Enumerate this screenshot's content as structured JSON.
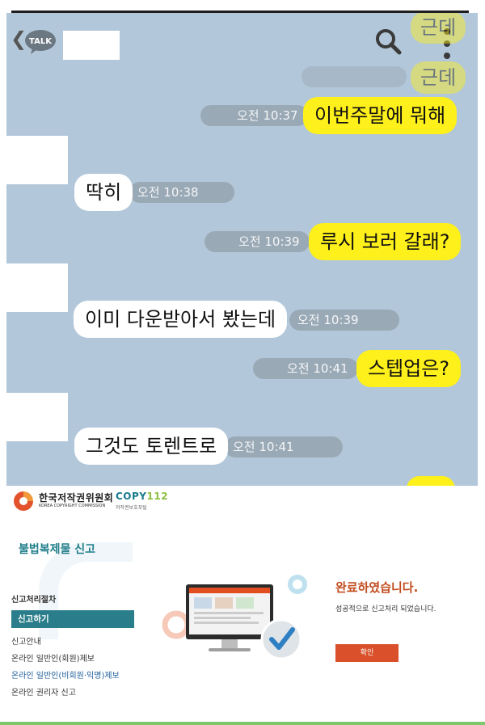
{
  "chat": {
    "app_icon_label": "TALK",
    "messages": [
      {
        "side": "me",
        "text": "이번주말에 뭐해",
        "time": "오전 10:37"
      },
      {
        "side": "them",
        "text": "딱히",
        "time": "오전 10:38"
      },
      {
        "side": "me",
        "text": "루시 보러 갈래?",
        "time": "오전 10:39"
      },
      {
        "side": "them",
        "text": "이미 다운받아서 봤는데",
        "time": "오전 10:39"
      },
      {
        "side": "me",
        "text": "스텝업은?",
        "time": "오전 10:41"
      },
      {
        "side": "them",
        "text": "그것도 토렌트로",
        "time": "오전 10:41"
      }
    ],
    "ghost_bubble_text": "근데",
    "icons": [
      "back-chevron-icon",
      "talk-icon",
      "search-icon",
      "kebab-menu-icon"
    ],
    "colors": {
      "background": "#b2c7d9",
      "my_bubble": "#fef01b",
      "their_bubble": "#ffffff"
    }
  },
  "site": {
    "org_name_ko": "한국저작권위원회",
    "org_name_en": "KOREA COPYRIGHT COMMISSION",
    "portal_brand_main": "COPY",
    "portal_brand_num": "112",
    "portal_sub": "저작권보호포털",
    "section_title": "불법복제물 신고",
    "sidebar": {
      "header": "신고처리절차",
      "active": "신고하기",
      "items": [
        "신고안내",
        "온라인 일반인(회원)제보",
        "온라인 일반인(비회원·익명)제보",
        "온라인 권리자 신고"
      ]
    },
    "result_title": "완료하였습니다.",
    "result_message": "성공적으로 신고처리 되었습니다.",
    "confirm_button": "확인",
    "colors": {
      "accent": "#2a7d8a",
      "title_red": "#c24d1f",
      "button": "#d9502a"
    }
  }
}
